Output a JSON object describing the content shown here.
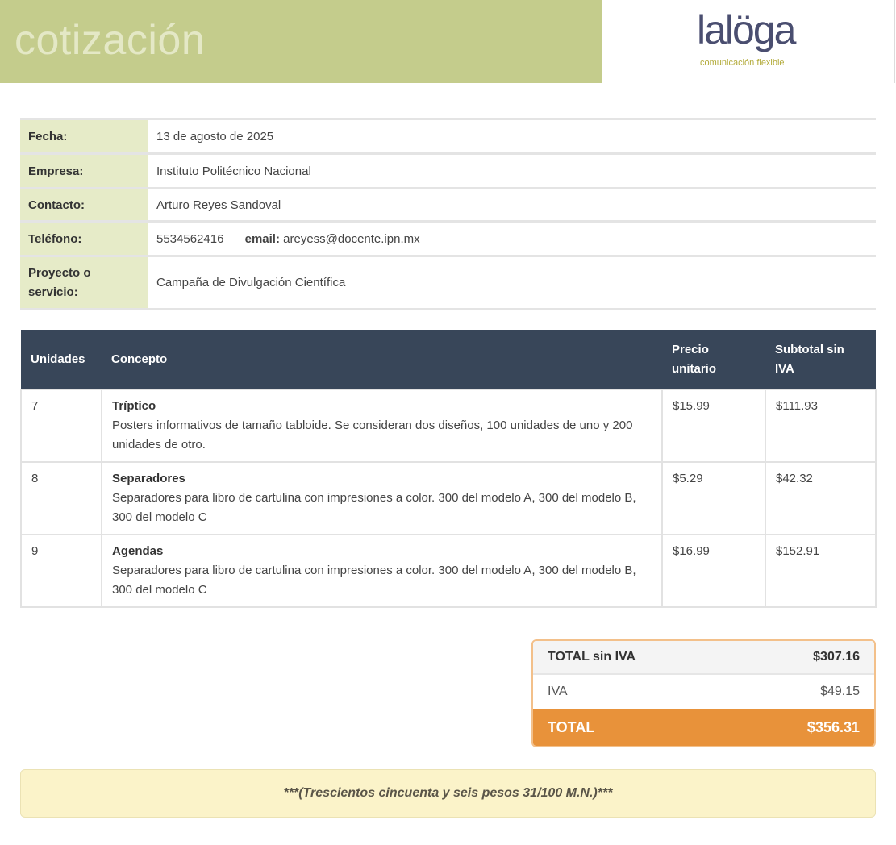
{
  "header": {
    "title": "cotización",
    "logo_text": "lalöga",
    "logo_tagline": "comunicación flexible"
  },
  "info": {
    "fecha_label": "Fecha:",
    "fecha_value": "13 de agosto de 2025",
    "empresa_label": "Empresa:",
    "empresa_value": "Instituto Politécnico Nacional",
    "contacto_label": "Contacto:",
    "contacto_value": "Arturo Reyes Sandoval",
    "telefono_label": "Teléfono:",
    "telefono_value": "5534562416",
    "email_label": "email:",
    "email_value": "areyess@docente.ipn.mx",
    "proyecto_label": "Proyecto o servicio:",
    "proyecto_value": "Campaña de Divulgación Científica"
  },
  "items": {
    "headers": {
      "unidades": "Unidades",
      "concepto": "Concepto",
      "precio": "Precio unitario",
      "subtotal": "Subtotal sin IVA"
    },
    "rows": [
      {
        "units": "7",
        "name": "Tríptico",
        "description": "Posters informativos de tamaño tabloide. Se consideran dos diseños, 100 unidades de uno y 200 unidades de otro.",
        "price": "$15.99",
        "subtotal": "$111.93"
      },
      {
        "units": "8",
        "name": "Separadores",
        "description": "Separadores para libro de cartulina con impresiones a color. 300 del modelo A, 300 del modelo B, 300 del modelo C",
        "price": "$5.29",
        "subtotal": "$42.32"
      },
      {
        "units": "9",
        "name": "Agendas",
        "description": "Separadores para libro de cartulina con impresiones a color. 300 del modelo A, 300 del modelo B, 300 del modelo C",
        "price": "$16.99",
        "subtotal": "$152.91"
      }
    ]
  },
  "totals": {
    "subtotal_label": "TOTAL sin IVA",
    "subtotal_value": "$307.16",
    "iva_label": "IVA",
    "iva_value": "$49.15",
    "total_label": "TOTAL",
    "total_value": "$356.31"
  },
  "amount_in_words": "***(Trescientos cincuenta y seis pesos 31/100 M.N.)***",
  "colors": {
    "banner": "#c4cc8c",
    "label_bg": "#e6ebc8",
    "table_header": "#384659",
    "total_accent": "#e8923a",
    "words_bg": "#fbf3c9"
  }
}
